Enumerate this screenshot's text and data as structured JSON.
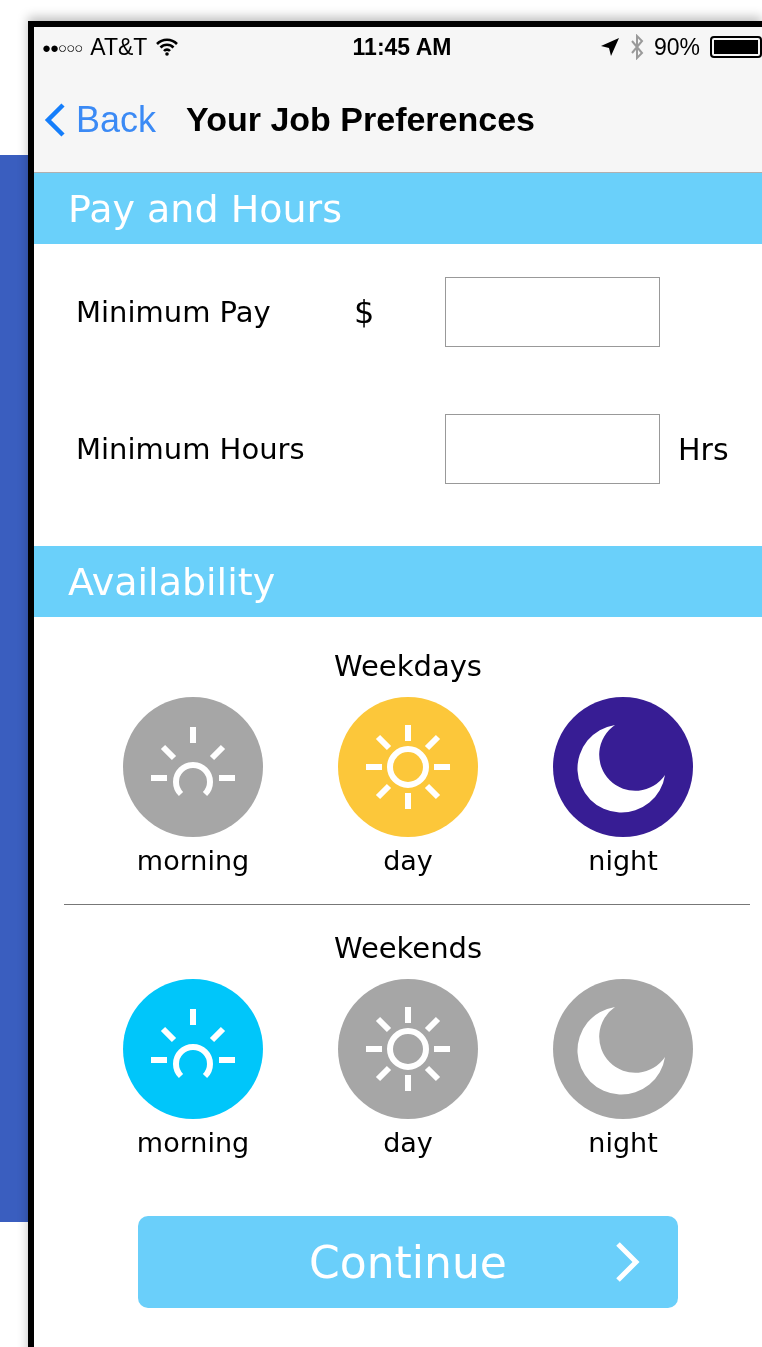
{
  "status_bar": {
    "signal": "●●○○○",
    "carrier": "AT&T",
    "time": "11:45 AM",
    "battery": "90%"
  },
  "nav": {
    "back": "Back",
    "title": "Your Job Preferences"
  },
  "pay_section": {
    "title": "Pay and Hours",
    "fields": [
      {
        "label": "Minimum Pay",
        "prefix": "$"
      },
      {
        "label": "Minimum Hours",
        "suffix": "Hrs"
      }
    ]
  },
  "availability": {
    "title": "Availability",
    "groups": [
      {
        "title": "Weekdays",
        "slots": [
          {
            "kind": "morning",
            "label": "morning",
            "selected": false
          },
          {
            "kind": "day",
            "label": "day",
            "selected": true
          },
          {
            "kind": "night",
            "label": "night",
            "selected": true
          }
        ]
      },
      {
        "title": "Weekends",
        "slots": [
          {
            "kind": "morning",
            "label": "morning",
            "selected": true
          },
          {
            "kind": "day",
            "label": "day",
            "selected": false
          },
          {
            "kind": "night",
            "label": "night",
            "selected": false
          }
        ]
      }
    ]
  },
  "continue_button": {
    "label": "Continue"
  }
}
